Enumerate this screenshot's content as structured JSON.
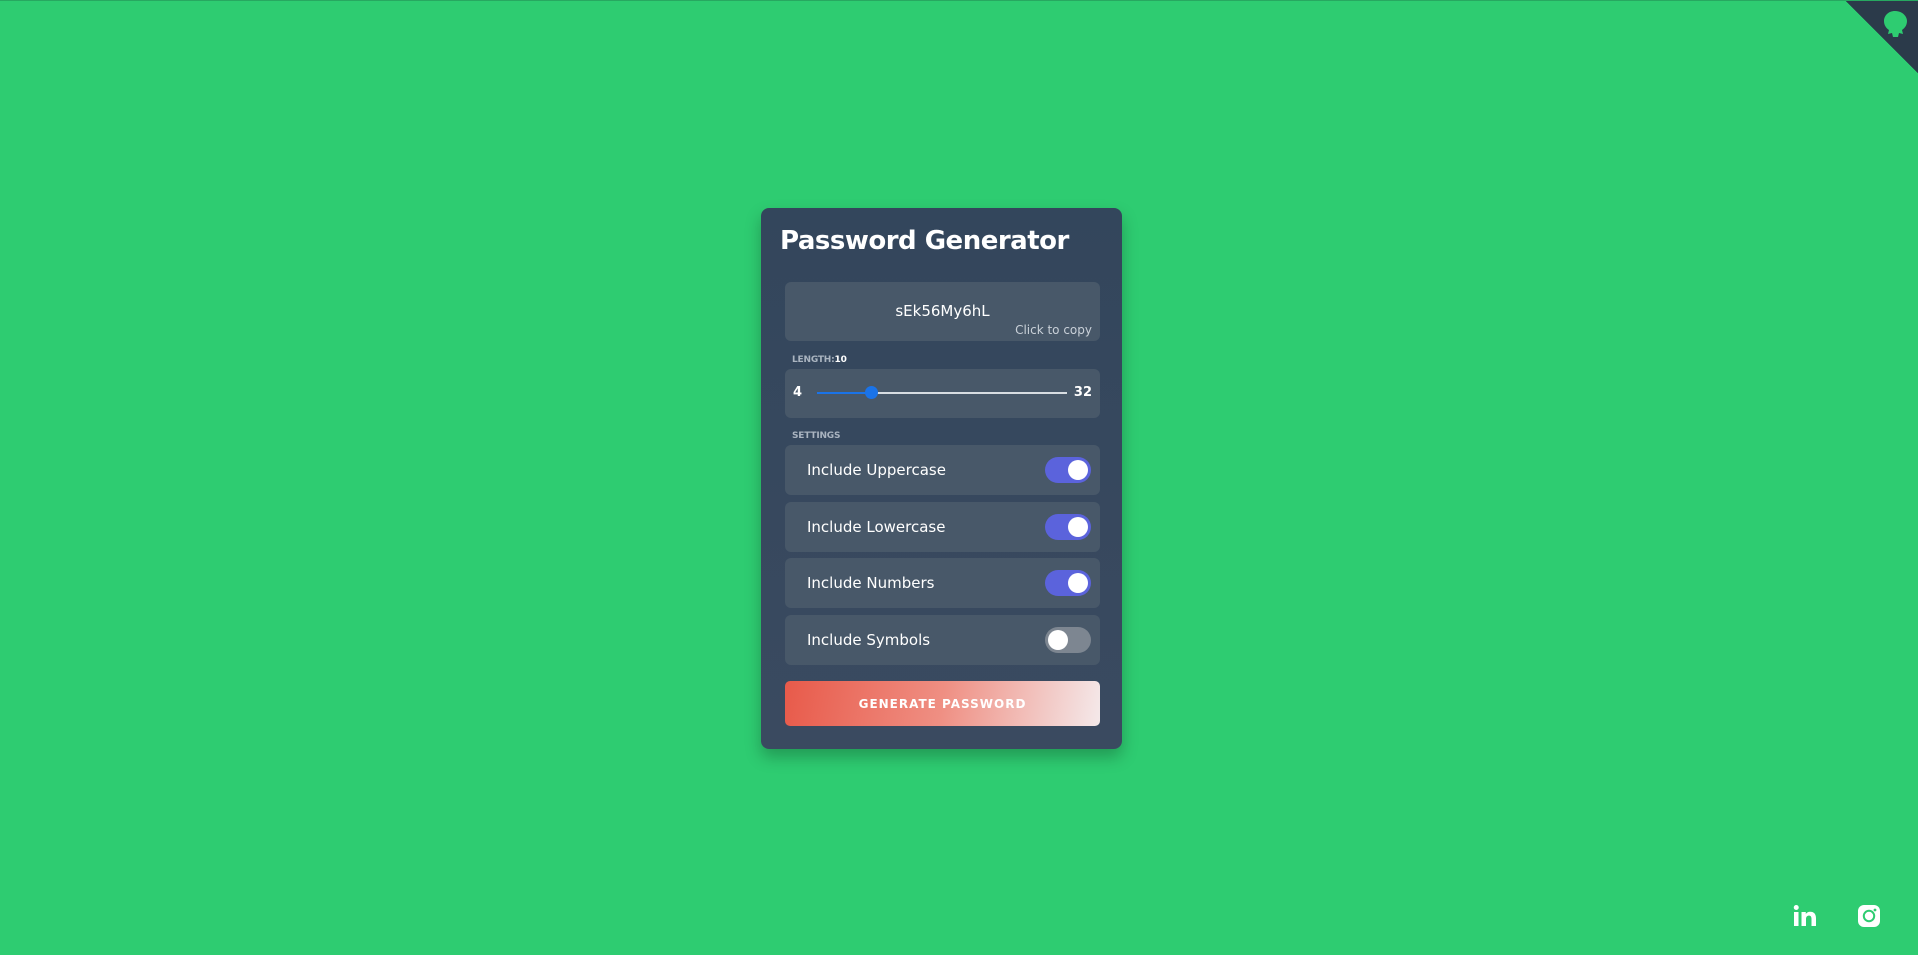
{
  "app": {
    "title": "Password Generator",
    "background_color": "#2ecc71",
    "card_color": "#33465c",
    "accent_color": "#5b63dc"
  },
  "result": {
    "password": "sEk56My6hL",
    "copy_hint": "Click to copy"
  },
  "length": {
    "label": "LENGTH:",
    "value": "10",
    "min": "4",
    "max": "32",
    "current": 10,
    "min_value": 4,
    "max_value": 32
  },
  "settings": {
    "label": "SETTINGS",
    "items": [
      {
        "label": "Include Uppercase",
        "enabled": true
      },
      {
        "label": "Include Lowercase",
        "enabled": true
      },
      {
        "label": "Include Numbers",
        "enabled": true
      },
      {
        "label": "Include Symbols",
        "enabled": false
      }
    ]
  },
  "actions": {
    "generate_label": "GENERATE PASSWORD"
  },
  "icons": {
    "corner": "github-octocat-icon",
    "social": [
      "linkedin-icon",
      "instagram-icon"
    ]
  }
}
